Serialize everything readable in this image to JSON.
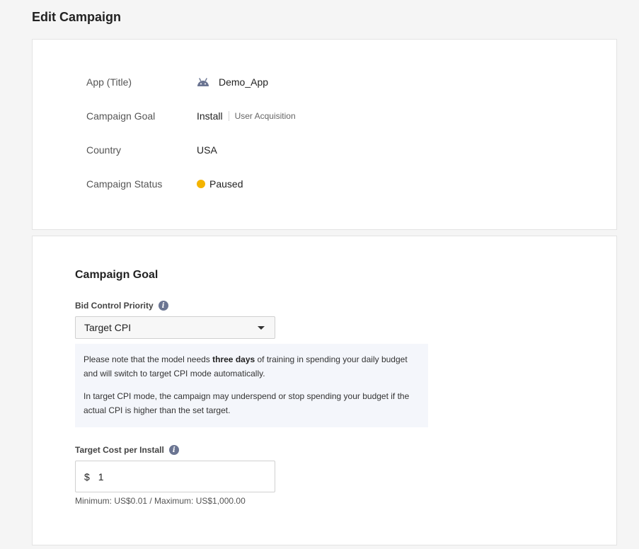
{
  "page": {
    "title": "Edit Campaign"
  },
  "summary": {
    "rows": [
      {
        "label": "App (Title)",
        "value": "Demo_App",
        "icon": "android-icon"
      },
      {
        "label": "Campaign Goal",
        "value": "Install",
        "sub": "User Acquisition"
      },
      {
        "label": "Country",
        "value": "USA"
      },
      {
        "label": "Campaign Status",
        "value": "Paused",
        "status_color": "#f4b400"
      }
    ]
  },
  "goal_section": {
    "title": "Campaign Goal",
    "bid_control": {
      "label": "Bid Control Priority",
      "selected": "Target CPI",
      "info_icon": "i"
    },
    "notice": {
      "p1_before": "Please note that the model needs ",
      "p1_bold": "three days",
      "p1_after": " of training in spending your daily budget and will switch to target CPI mode automatically.",
      "p2": "In target CPI mode, the campaign may underspend or stop spending your budget if the actual CPI is higher than the set target."
    },
    "target_cost": {
      "label": "Target Cost per Install",
      "currency": "$",
      "value": "1",
      "hint": "Minimum: US$0.01 / Maximum: US$1,000.00",
      "info_icon": "i"
    }
  },
  "colors": {
    "accent_info": "#6b7592",
    "status_paused": "#f4b400",
    "notice_bg": "#f4f6fb"
  }
}
